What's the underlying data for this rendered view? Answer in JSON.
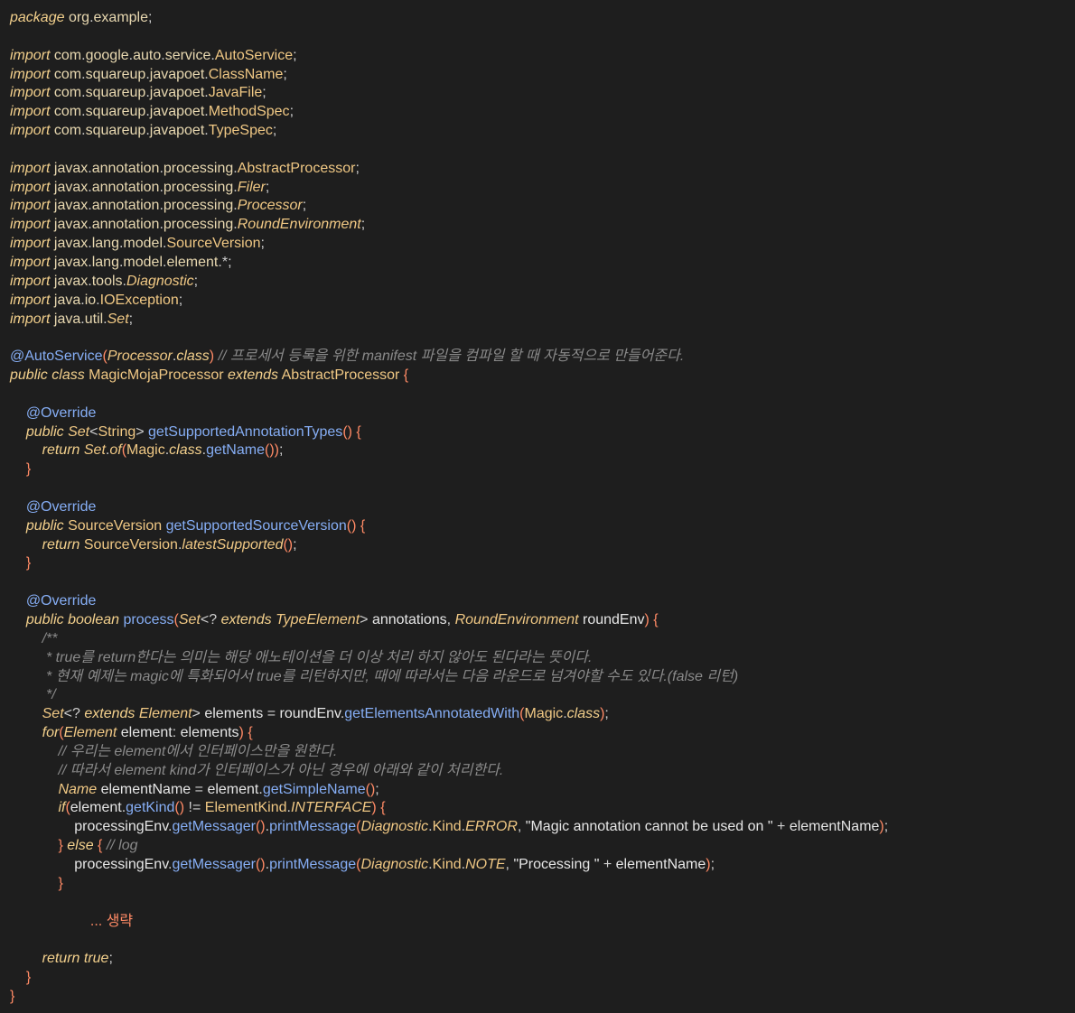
{
  "editor": {
    "language": "java",
    "background": "#1e1e1e",
    "theme_colors": {
      "keyword": "#f3d08c",
      "class": "#f0c884",
      "method": "#86aef5",
      "paren": "#ff8a65",
      "comment": "#8a8a8a",
      "text": "#e6e6e6"
    }
  },
  "code_lines": [
    "package org.example;",
    "",
    "import com.google.auto.service.AutoService;",
    "import com.squareup.javapoet.ClassName;",
    "import com.squareup.javapoet.JavaFile;",
    "import com.squareup.javapoet.MethodSpec;",
    "import com.squareup.javapoet.TypeSpec;",
    "",
    "import javax.annotation.processing.AbstractProcessor;",
    "import javax.annotation.processing.Filer;",
    "import javax.annotation.processing.Processor;",
    "import javax.annotation.processing.RoundEnvironment;",
    "import javax.lang.model.SourceVersion;",
    "import javax.lang.model.element.*;",
    "import javax.tools.Diagnostic;",
    "import java.io.IOException;",
    "import java.util.Set;",
    "",
    "@AutoService(Processor.class) // 프로세서 등록을 위한 manifest 파일을 컴파일 할 때 자동적으로 만들어준다.",
    "public class MagicMojaProcessor extends AbstractProcessor {",
    "",
    "    @Override",
    "    public Set<String> getSupportedAnnotationTypes() {",
    "        return Set.of(Magic.class.getName());",
    "    }",
    "",
    "    @Override",
    "    public SourceVersion getSupportedSourceVersion() {",
    "        return SourceVersion.latestSupported();",
    "    }",
    "",
    "    @Override",
    "    public boolean process(Set<? extends TypeElement> annotations, RoundEnvironment roundEnv) {",
    "        /**",
    "         * true를 return한다는 의미는 해당 애노테이션을 더 이상 처리 하지 않아도 된다라는 뜻이다.",
    "         * 현재 예제는 magic에 특화되어서 true를 리턴하지만, 때에 따라서는 다음 라운드로 넘겨야할 수도 있다.(false 리턴)",
    "         */",
    "        Set<? extends Element> elements = roundEnv.getElementsAnnotatedWith(Magic.class);",
    "        for(Element element: elements) {",
    "            // 우리는 element에서 인터페이스만을 원한다.",
    "            // 따라서 element kind가 인터페이스가 아닌 경우에 아래와 같이 처리한다.",
    "            Name elementName = element.getSimpleName();",
    "            if(element.getKind() != ElementKind.INTERFACE) {",
    "                processingEnv.getMessager().printMessage(Diagnostic.Kind.ERROR, \"Magic annotation cannot be used on \" + elementName);",
    "            } else { // log",
    "                processingEnv.getMessager().printMessage(Diagnostic.Kind.NOTE, \"Processing \" + elementName);",
    "            }",
    "",
    "                    ... 생략",
    "",
    "        return true;",
    "    }",
    "}"
  ]
}
